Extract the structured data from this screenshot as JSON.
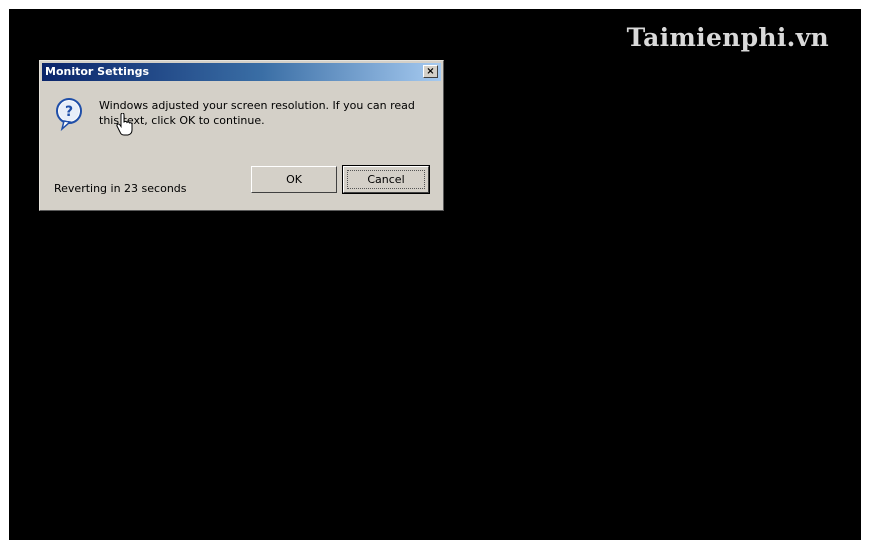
{
  "watermark": "Taimienphi.vn",
  "dialog": {
    "title": "Monitor Settings",
    "close_label": "×",
    "icon": "question-icon",
    "message": "Windows adjusted your screen resolution. If you can read this text, click OK to continue.",
    "countdown": "Reverting in 23 seconds",
    "ok_label": "OK",
    "cancel_label": "Cancel"
  },
  "colors": {
    "desktop": "#000000",
    "dialog_bg": "#d4d0c8",
    "titlebar_start": "#0a246a",
    "titlebar_end": "#a6caf0"
  }
}
